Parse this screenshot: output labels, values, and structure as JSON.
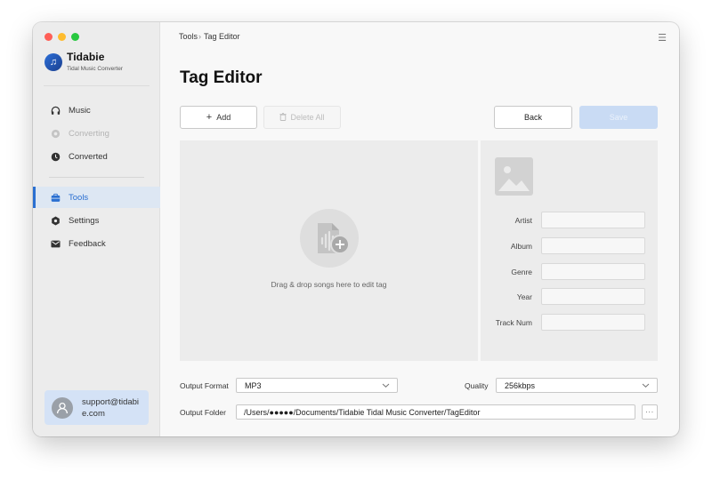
{
  "app": {
    "name": "Tidabie",
    "subtitle": "Tidal Music Converter"
  },
  "sidebar": {
    "items": [
      {
        "label": "Music",
        "icon": "headphones-icon",
        "state": "normal"
      },
      {
        "label": "Converting",
        "icon": "converting-icon",
        "state": "disabled"
      },
      {
        "label": "Converted",
        "icon": "clock-icon",
        "state": "normal"
      },
      {
        "label": "Tools",
        "icon": "toolbox-icon",
        "state": "active"
      },
      {
        "label": "Settings",
        "icon": "gear-icon",
        "state": "normal"
      },
      {
        "label": "Feedback",
        "icon": "mail-icon",
        "state": "normal"
      }
    ],
    "account": {
      "email": "support@tidabie.com"
    }
  },
  "header": {
    "breadcrumb": [
      "Tools",
      "Tag Editor"
    ],
    "title": "Tag Editor"
  },
  "toolbar": {
    "add_label": "Add",
    "delete_label": "Delete All",
    "back_label": "Back",
    "save_label": "Save"
  },
  "dropzone": {
    "text": "Drag & drop songs here to edit tag"
  },
  "tag_fields": [
    {
      "label": "Artist",
      "value": ""
    },
    {
      "label": "Album",
      "value": ""
    },
    {
      "label": "Genre",
      "value": ""
    },
    {
      "label": "Year",
      "value": ""
    },
    {
      "label": "Track Num",
      "value": ""
    }
  ],
  "output": {
    "format_label": "Output Format",
    "format_value": "MP3",
    "quality_label": "Quality",
    "quality_value": "256kbps",
    "folder_label": "Output Folder",
    "folder_value": "/Users/●●●●●/Documents/Tidabie Tidal Music Converter/TagEditor",
    "browse_label": "···"
  },
  "colors": {
    "accent": "#2a6fd1",
    "active_bg": "#dde7f3",
    "save_disabled": "#c9dbf4"
  }
}
